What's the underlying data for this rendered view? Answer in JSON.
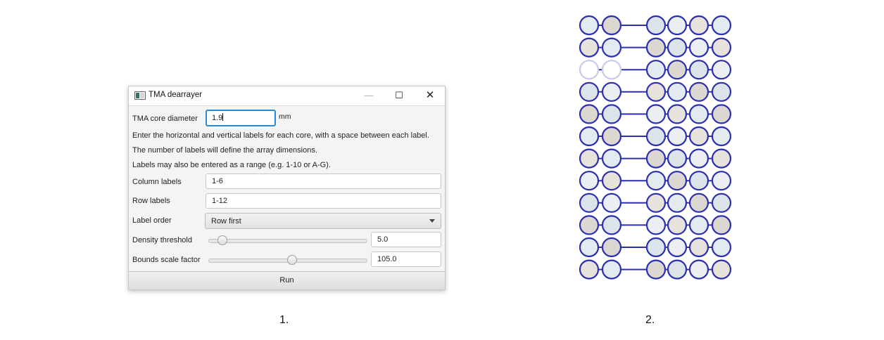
{
  "dialog": {
    "title": "TMA dearrayer",
    "core_diameter": {
      "label": "TMA core diameter",
      "value": "1.9",
      "unit": "mm"
    },
    "instructions": [
      "Enter the horizontal and vertical labels for each core, with a space between each label.",
      "The number of labels will define the array dimensions.",
      "Labels may also be entered as a range (e.g. 1-10 or A-G)."
    ],
    "column_labels": {
      "label": "Column labels",
      "value": "1-6"
    },
    "row_labels": {
      "label": "Row labels",
      "value": "1-12"
    },
    "label_order": {
      "label": "Label order",
      "value": "Row first"
    },
    "density_threshold": {
      "label": "Density threshold",
      "value": "5.0",
      "slider_fraction": 0.06
    },
    "bounds_scale": {
      "label": "Bounds scale factor",
      "value": "105.0",
      "slider_fraction": 0.53
    },
    "run_label": "Run"
  },
  "captions": {
    "left": "1.",
    "right": "2."
  },
  "tma_grid": {
    "columns": 6,
    "rows": 12,
    "missing_cores": [
      [
        2,
        0
      ],
      [
        2,
        1
      ]
    ],
    "ring_color": "#2b2fb0",
    "missing_ring_color": "#c8cbe8"
  },
  "colors": {
    "focus": "#2a8bd3"
  }
}
